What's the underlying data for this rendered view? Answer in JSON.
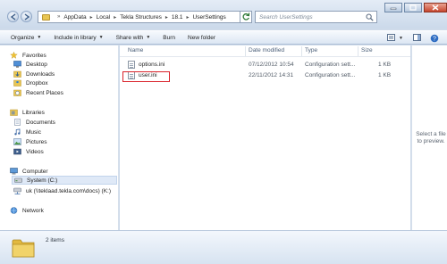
{
  "address": {
    "crumbs": [
      "AppData",
      "Local",
      "Tekla Structures",
      "18.1",
      "UserSettings"
    ]
  },
  "search": {
    "placeholder": "Search UserSettings"
  },
  "toolbar": {
    "organize": "Organize",
    "include_in_library": "Include in library",
    "share_with": "Share with",
    "burn": "Burn",
    "new_folder": "New folder"
  },
  "nav": {
    "favorites": "Favorites",
    "desktop": "Desktop",
    "downloads": "Downloads",
    "dropbox": "Dropbox",
    "recent_places": "Recent Places",
    "libraries": "Libraries",
    "documents": "Documents",
    "music": "Music",
    "pictures": "Pictures",
    "videos": "Videos",
    "computer": "Computer",
    "system_c": "System (C:)",
    "network_drive": "uk (\\\\teklaad.tekla.com\\docs) (K:)",
    "network": "Network"
  },
  "columns": {
    "name": "Name",
    "date_modified": "Date modified",
    "type": "Type",
    "size": "Size"
  },
  "files": [
    {
      "name": "options.ini",
      "date": "07/12/2012 10:54",
      "type": "Configuration sett...",
      "size": "1 KB"
    },
    {
      "name": "user.ini",
      "date": "22/11/2012 14:31",
      "type": "Configuration sett...",
      "size": "1 KB"
    }
  ],
  "preview": {
    "text": "Select a file to preview."
  },
  "details": {
    "item_count": "2 items"
  },
  "colors": {
    "highlight_border": "#d9222a",
    "folder": "#e9c653",
    "chrome": "#cfdbea"
  }
}
